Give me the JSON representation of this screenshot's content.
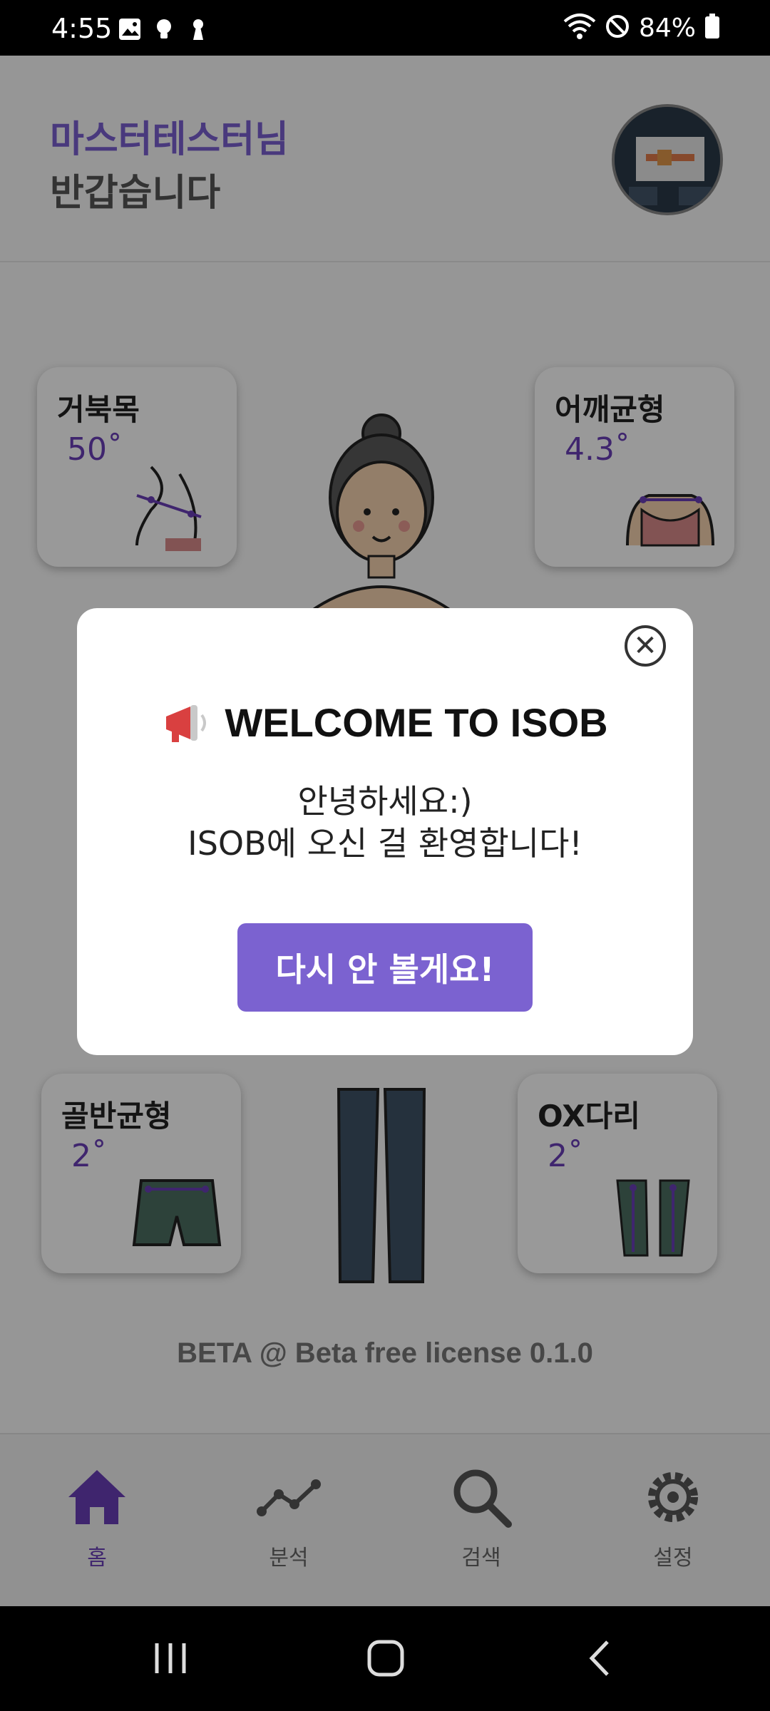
{
  "status_bar": {
    "time": "4:55",
    "battery": "84%"
  },
  "header": {
    "name": "마스터테스터님",
    "greeting": "반갑습니다"
  },
  "cards": {
    "neck": {
      "title": "거북목",
      "value": "50˚"
    },
    "shoulder": {
      "title": "어깨균형",
      "value": "4.3˚"
    },
    "pelvis": {
      "title": "골반균형",
      "value": "2˚"
    },
    "legs": {
      "title": "OX다리",
      "value": "2˚"
    }
  },
  "footer": {
    "license": "BETA  @ Beta free license 0.1.0"
  },
  "bottom_nav": {
    "items": [
      {
        "label": "홈",
        "icon": "home-icon",
        "active": true
      },
      {
        "label": "분석",
        "icon": "analysis-icon",
        "active": false
      },
      {
        "label": "검색",
        "icon": "search-icon",
        "active": false
      },
      {
        "label": "설정",
        "icon": "gear-icon",
        "active": false
      }
    ]
  },
  "modal": {
    "title": "WELCOME TO ISOB",
    "message_line1": "안녕하세요:)",
    "message_line2": "ISOB에 오신 걸 환영합니다!",
    "button_label": "다시 안 볼게요!",
    "close_symbol": "✕"
  },
  "colors": {
    "accent": "#7b62d0",
    "accent_dark": "#6a3fb8"
  }
}
